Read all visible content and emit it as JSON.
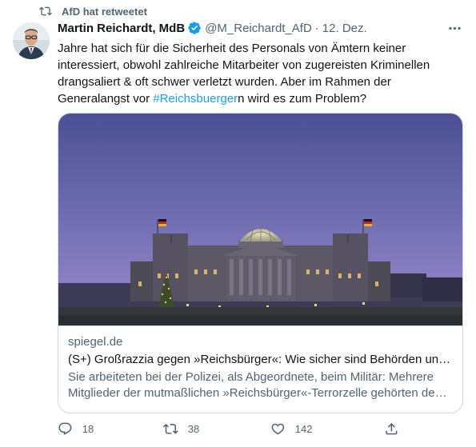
{
  "retweet": {
    "label": "AfD hat retweetet",
    "icon": "retweet-icon"
  },
  "author": {
    "display_name": "Martin Reichardt, MdB",
    "handle": "@M_Reichardt_AfD",
    "separator": "·",
    "date": "12. Dez.",
    "verified_icon": "verified-badge-icon",
    "verified_color": "#1d9bf0"
  },
  "tweet": {
    "text_part1": "Jahre hat sich für die Sicherheit des Personals von Ämtern keiner interessiert, obwohl zahlreiche Mitarbeiter von zugereisten Kriminellen drangsaliert & oft schwer verletzt wurden. Aber im Rahmen der Generalangst vor ",
    "hashtag": "#Reichsbuerger",
    "text_part2": "n wird es zum Problem?"
  },
  "card": {
    "domain": "spiegel.de",
    "title": "(S+) Großrazzia gegen »Reichsbürger«: Wie sicher sind Behörden und ...",
    "desc_line1": "Sie arbeiteten bei der Polizei, als Abgeordnete, beim Militär: Mehrere",
    "desc_line2": "Mitglieder der mutmaßlichen »Reichsbürger«-Terrorzelle gehörten dem..."
  },
  "actions": {
    "reply_count": "18",
    "retweet_count": "38",
    "like_count": "142"
  },
  "colors": {
    "accent": "#1d9bf0",
    "secondary_text": "#536471",
    "primary_text": "#0f1419",
    "border": "#cfd9de"
  }
}
